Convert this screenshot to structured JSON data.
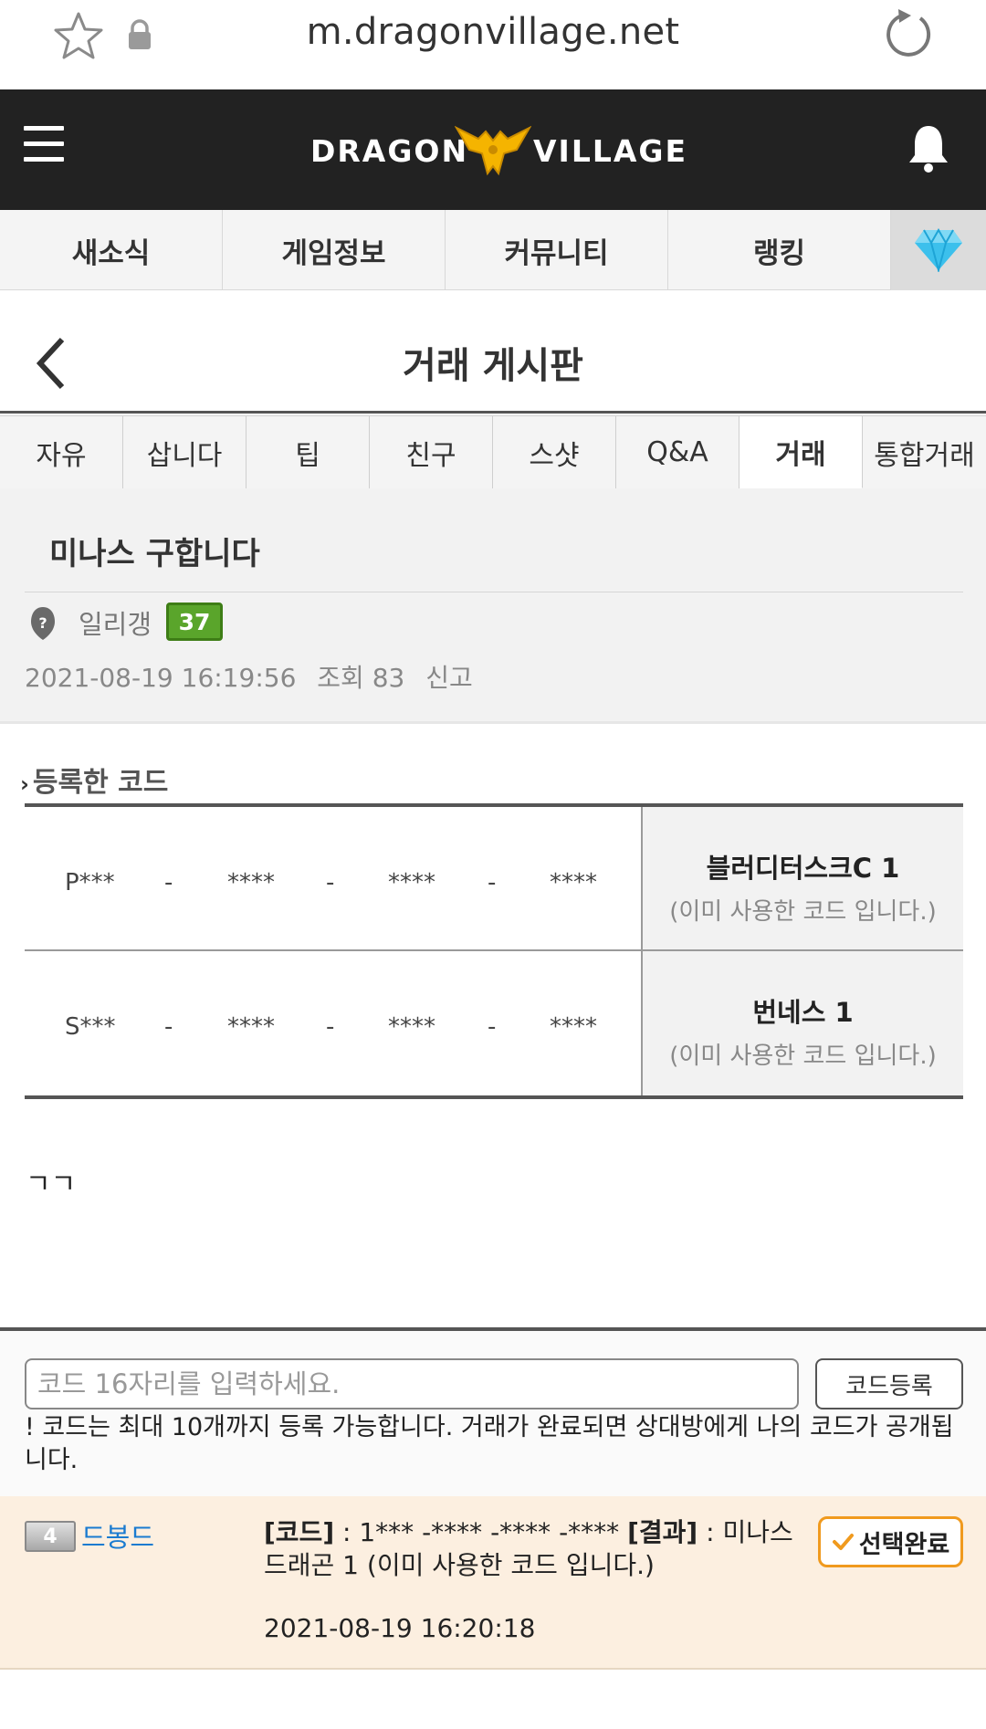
{
  "browser": {
    "url": "m.dragonvillage.net"
  },
  "header": {
    "logo_left": "DRAGON",
    "logo_right": "VILLAGE",
    "colors": {
      "bar": "#222222",
      "logo_gold": "#f5b400"
    }
  },
  "main_nav": {
    "items": [
      "새소식",
      "게임정보",
      "커뮤니티",
      "랭킹"
    ],
    "gem_icon": "diamond-icon"
  },
  "page": {
    "title": "거래 게시판"
  },
  "board_tabs": [
    {
      "label": "자유"
    },
    {
      "label": "삽니다"
    },
    {
      "label": "팁"
    },
    {
      "label": "친구"
    },
    {
      "label": "스샷"
    },
    {
      "label": "Q&A"
    },
    {
      "label": "거래",
      "active": true
    },
    {
      "label": "통합거래"
    }
  ],
  "post": {
    "title": "미나스 구합니다",
    "author": "일리갱",
    "level": "37",
    "datetime": "2021-08-19 16:19:56",
    "views": "조회 83",
    "report": "신고",
    "body": "ㄱㄱ"
  },
  "codes": {
    "label": "등록한 코드",
    "rows": [
      {
        "segments": [
          "P***",
          "-",
          "****",
          "-",
          "****",
          "-",
          "****"
        ],
        "name": "블러디터스크C 1",
        "status": "(이미 사용한 코드 입니다.)"
      },
      {
        "segments": [
          "S***",
          "-",
          "****",
          "-",
          "****",
          "-",
          "****"
        ],
        "name": "번네스 1",
        "status": "(이미 사용한 코드 입니다.)"
      }
    ]
  },
  "code_form": {
    "placeholder": "코드 16자리를 입력하세요.",
    "value": "",
    "submit": "코드등록",
    "notice": "! 코드는 최대 10개까지 등록 가능합니다. 거래가 완료되면 상대방에게 나의 코드가 공개됩니다."
  },
  "comment": {
    "level": "4",
    "author": "드봉드",
    "code_label": "[코드]",
    "code_value": " : 1*** -**** -**** -**** ",
    "result_label": "[결과]",
    "result_value": " : 미나스 드래곤 1 (이미 사용한 코드 입니다.)",
    "datetime": "2021-08-19 16:20:18",
    "badge": "선택완료"
  }
}
